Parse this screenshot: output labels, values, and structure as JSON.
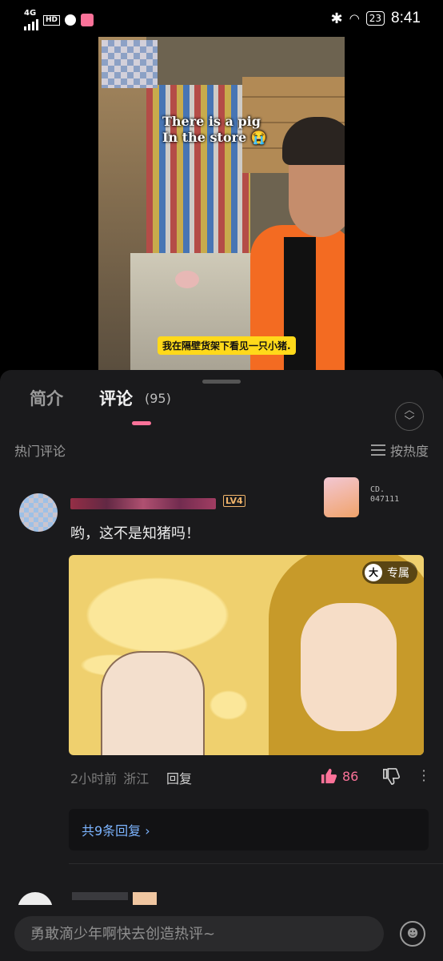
{
  "status_bar": {
    "network": "4G",
    "hd": "HD",
    "battery": "23",
    "time": "8:41"
  },
  "video": {
    "caption_top": "There is a pig\nIn the store 😭",
    "caption_bottom": "我在隔壁货架下看见一只小猪."
  },
  "tabs": {
    "intro": "简介",
    "comments": "评论",
    "comment_count": "(95)"
  },
  "section": {
    "title": "热门评论",
    "sort_label": "按热度"
  },
  "comment": {
    "level": "LV4",
    "fan_number": "CD.\n047111",
    "text": "哟，这不是知猪吗！",
    "image_tag": "专属",
    "image_tag_icon": "大",
    "time": "2小时前",
    "location": "浙江",
    "reply_label": "回复",
    "likes": "86",
    "replies_link": "共9条回复 ›"
  },
  "input": {
    "placeholder": "勇敢滴少年啊快去创造热评~"
  },
  "colors": {
    "accent": "#fb7299",
    "link": "#7cb4ff",
    "panel": "#1a1a1c"
  }
}
